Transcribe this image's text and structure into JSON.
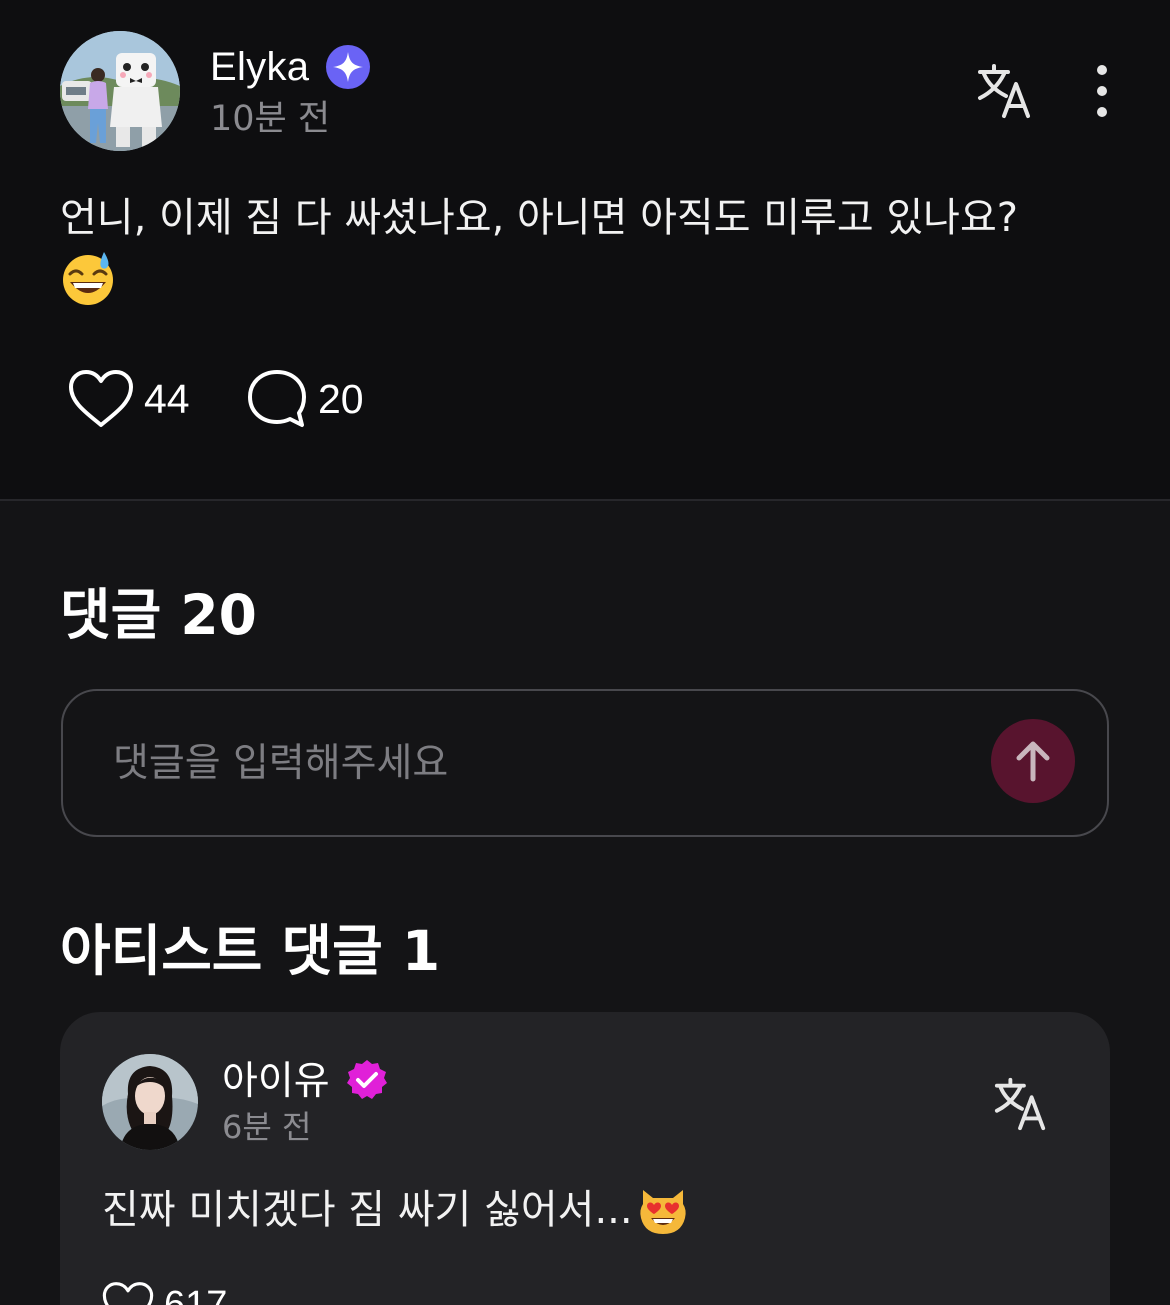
{
  "post": {
    "author": "Elyka",
    "time": "10분 전",
    "text": "언니, 이제 짐 다 싸셨나요, 아니면 아직도 미루고 있나요?",
    "text_emoji": "grinning-sweat-emoji",
    "likes": "44",
    "comments": "20",
    "icons": [
      "verified-star-badge",
      "translate-icon",
      "more-vertical-icon",
      "heart-icon",
      "comment-bubble-icon"
    ]
  },
  "comments_section": {
    "title": "댓글 20",
    "input_placeholder": "댓글을 입력해주세요",
    "input_value": "",
    "send_icon": "arrow-up-icon"
  },
  "artist_section": {
    "title": "아티스트 댓글 1",
    "comment": {
      "author": "아이유",
      "time": "6분 전",
      "text": "진짜 미치겠다 짐 싸기 싫어서...",
      "text_emoji": "heart-eyes-cat-emoji",
      "likes": "617"
    }
  },
  "colors": {
    "background": "#0e0e10",
    "comments_background": "#141416",
    "card_background": "#232326",
    "verified_blue": "#6a63f5",
    "verified_pink": "#e020d8",
    "send_button": "#58142e",
    "muted_text": "#8b8b90"
  }
}
